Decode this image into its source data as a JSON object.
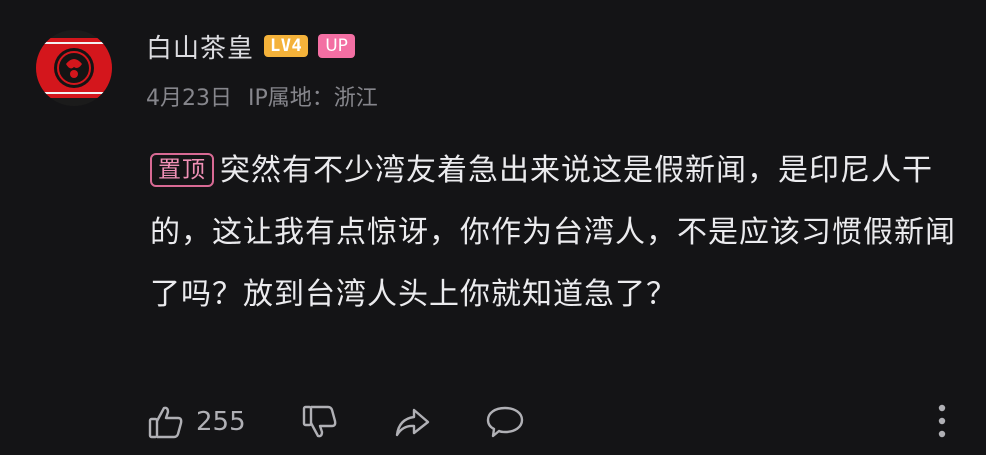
{
  "user": {
    "name": "白山茶皇",
    "level": "LV4",
    "up_badge": "UP"
  },
  "meta": {
    "date": "4月23日",
    "ip_location": "IP属地：浙江"
  },
  "comment": {
    "pinned_label": "置顶",
    "text": "突然有不少湾友着急出来说这是假新闻，是印尼人干的，这让我有点惊讶，你作为台湾人，不是应该习惯假新闻了吗？放到台湾人头上你就知道急了？"
  },
  "actions": {
    "like_count": "255",
    "icons": [
      "thumbs-up-icon",
      "thumbs-down-icon",
      "share-icon",
      "comment-icon",
      "more-vertical-icon"
    ]
  },
  "colors": {
    "background": "#141416",
    "level_badge": "#f4b23a",
    "up_badge": "#f36fa3",
    "pinned_border": "#d86a94"
  }
}
